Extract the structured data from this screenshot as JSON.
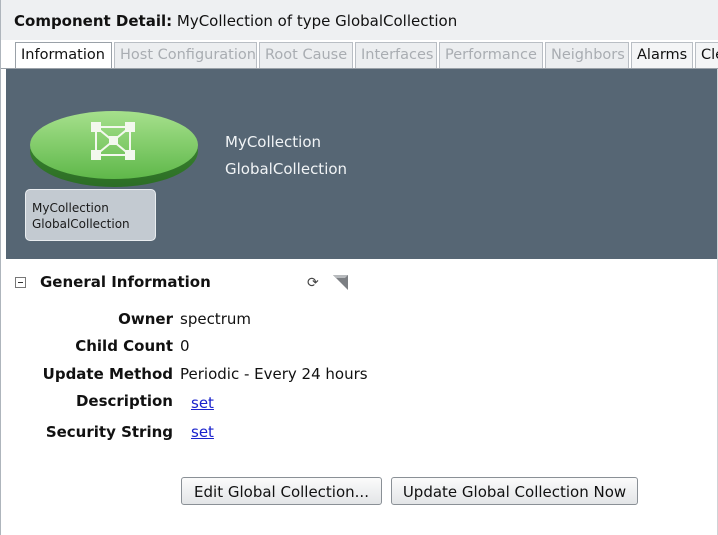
{
  "title": {
    "prefix": "Component Detail:",
    "text": "MyCollection of type GlobalCollection"
  },
  "tabs": [
    {
      "label": "Information",
      "state": "active"
    },
    {
      "label": "Host Configuration",
      "state": "disabled"
    },
    {
      "label": "Root Cause",
      "state": "disabled"
    },
    {
      "label": "Interfaces",
      "state": "disabled"
    },
    {
      "label": "Performance",
      "state": "disabled"
    },
    {
      "label": "Neighbors",
      "state": "disabled"
    },
    {
      "label": "Alarms",
      "state": "enabled"
    },
    {
      "label": "Cle",
      "state": "enabled"
    }
  ],
  "header": {
    "icon": "global-collection-icon",
    "badge_name": "MyCollection",
    "badge_type": "GlobalCollection",
    "name": "MyCollection",
    "type": "GlobalCollection"
  },
  "general_info": {
    "title": "General Information",
    "icons": [
      "refresh-icon",
      "tag-icon"
    ],
    "rows": [
      {
        "label": "Owner",
        "value": "spectrum"
      },
      {
        "label": "Child Count",
        "value": "0"
      },
      {
        "label": "Update Method",
        "value": "Periodic - Every 24 hours"
      },
      {
        "label": "Description",
        "link": "set"
      },
      {
        "label": "Security String",
        "link": "set"
      }
    ]
  },
  "buttons": {
    "edit": "Edit Global Collection...",
    "update": "Update Global Collection Now"
  },
  "colors": {
    "header_bg": "#566674",
    "disc_green": "#6fc45c",
    "link": "#1a22cc"
  }
}
